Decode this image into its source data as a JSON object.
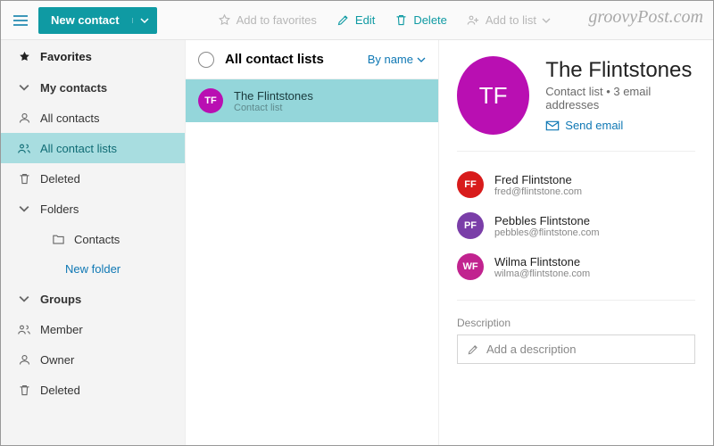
{
  "toolbar": {
    "new_contact_label": "New contact",
    "add_favorites_label": "Add to favorites",
    "edit_label": "Edit",
    "delete_label": "Delete",
    "add_to_list_label": "Add to list"
  },
  "brand": "groovyPost.com",
  "sidebar": {
    "favorites_label": "Favorites",
    "my_contacts_label": "My contacts",
    "all_contacts_label": "All contacts",
    "all_contact_lists_label": "All contact lists",
    "deleted_label": "Deleted",
    "folders_label": "Folders",
    "folder_contacts_label": "Contacts",
    "new_folder_label": "New folder",
    "groups_label": "Groups",
    "member_label": "Member",
    "owner_label": "Owner",
    "group_deleted_label": "Deleted"
  },
  "mid": {
    "header_title": "All contact lists",
    "sort_label": "By name",
    "items": [
      {
        "initials": "TF",
        "avatar_color": "#b90fb2",
        "title": "The Flintstones",
        "subtitle": "Contact list"
      }
    ]
  },
  "detail": {
    "title": "The Flintstones",
    "initials": "TF",
    "avatar_color": "#b90fb2",
    "subtitle": "Contact list • 3 email addresses",
    "send_email_label": "Send email",
    "members": [
      {
        "initials": "FF",
        "color": "#d81b1b",
        "name": "Fred Flintstone",
        "email": "fred@flintstone.com"
      },
      {
        "initials": "PF",
        "color": "#7a3ea8",
        "name": "Pebbles Flintstone",
        "email": "pebbles@flintstone.com"
      },
      {
        "initials": "WF",
        "color": "#c1238f",
        "name": "Wilma Flintstone",
        "email": "wilma@flintstone.com"
      }
    ],
    "description_label": "Description",
    "add_description_placeholder": "Add a description"
  }
}
